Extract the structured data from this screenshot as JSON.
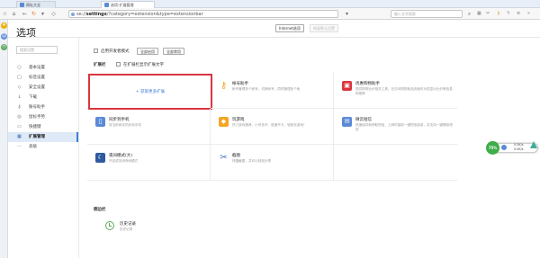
{
  "browser": {
    "tabs": [
      {
        "label": "网址大全",
        "active": false
      },
      {
        "label": "选项-扩展管理",
        "active": true
      }
    ],
    "address": {
      "prefix": "se://",
      "bold": "settings",
      "rest": "/?category=extension&type=extensionbar"
    },
    "search_placeholder": "输入文字搜索"
  },
  "page": {
    "title": "选项",
    "internet_button": "Internet选项",
    "restore_button": "恢复默认设置",
    "search_placeholder": "搜索设置"
  },
  "nav": {
    "items": [
      {
        "label": "基本设置",
        "icon": "circle-icon",
        "glyph": "○"
      },
      {
        "label": "标签设置",
        "icon": "tab-icon",
        "glyph": "□"
      },
      {
        "label": "安全设置",
        "icon": "shield-icon",
        "glyph": "◇"
      },
      {
        "label": "下载",
        "icon": "download-icon",
        "glyph": "↓"
      },
      {
        "label": "账号助手",
        "icon": "key-icon",
        "glyph": "⚷"
      },
      {
        "label": "鼠标手势",
        "icon": "gesture-icon",
        "glyph": "◎"
      },
      {
        "label": "快捷键",
        "icon": "keyboard-icon",
        "glyph": "▭"
      },
      {
        "label": "扩展管理",
        "icon": "grid-icon",
        "glyph": "▦",
        "active": true
      },
      {
        "label": "高级",
        "icon": "more-icon",
        "glyph": "⋯"
      }
    ]
  },
  "content": {
    "dev_mode_label": "启用开发者模式",
    "enable_all": "全部启用",
    "disable_all": "全部禁用",
    "extension_bar_label": "扩展栏",
    "show_text_label": "在扩展栏显示扩展文字",
    "add_more_label": "+ 获取更多扩展",
    "extensions": [
      {
        "name": "帐号助手",
        "desc": "帐号管理多个帐号，切换帐号，同时管理多个帐",
        "color": "#f4a623",
        "glyph": "⚷",
        "icon": "key-icon"
      },
      {
        "name": "优惠购物助手",
        "desc": "提供购物比价相关工具，在访问购物商品页面时为您显示比价等信息和推荐",
        "color": "#d9363e",
        "glyph": "▣",
        "icon": "shopping-icon"
      },
      {
        "name": "同步到手机",
        "desc": "将当前网页同步到手机",
        "color": "#5b8bd6",
        "glyph": "▯",
        "icon": "phone-icon"
      },
      {
        "name": "玩游戏",
        "desc": "热门游戏推荐，小号多开，极速不卡，轻松玩游戏！",
        "color": "#f4a623",
        "glyph": "◆",
        "icon": "game-icon"
      },
      {
        "name": "微云短信",
        "desc": "快速保存和获取短信，上网时接收一键短信接收，并支持一键删除短信",
        "color": "#5b8bd6",
        "glyph": "✉",
        "icon": "sms-icon"
      },
      {
        "name": "夜间模式(大)",
        "desc": "开启或关闭夜间模式",
        "color": "#2f5aa0",
        "glyph": "☾",
        "icon": "night-mode-icon"
      },
      {
        "name": "截图",
        "desc": "快捷截图，并可以轻松分享",
        "color": "#3c6fc9",
        "glyph": "✂",
        "icon": "scissors-icon"
      }
    ],
    "toolbar_label": "侧边栏",
    "history": {
      "name": "历史记录",
      "desc": "历史记录"
    }
  },
  "widget": {
    "percent": "75%",
    "up": "0.0K/s",
    "down": "0.0K/s"
  }
}
